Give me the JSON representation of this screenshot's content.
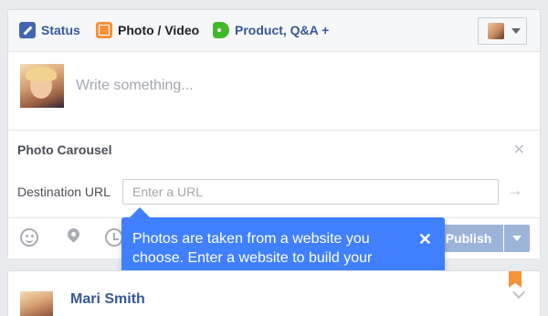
{
  "tabs": [
    {
      "label": "Status",
      "icon": "pencil-icon"
    },
    {
      "label": "Photo / Video",
      "icon": "photo-icon"
    },
    {
      "label": "Product, Q&A +",
      "icon": "tag-icon"
    }
  ],
  "composer": {
    "placeholder": "Write something...",
    "value": ""
  },
  "carousel": {
    "title": "Photo Carousel",
    "close_glyph": "✕",
    "url_label": "Destination URL",
    "url_placeholder": "Enter a URL",
    "url_value": "",
    "submit_glyph": "→"
  },
  "footer": {
    "publish_label": "Publish"
  },
  "tooltip": {
    "text": "Photos are taken from a website you choose. Enter a website to build your photo carousel.",
    "close_glyph": "✕"
  },
  "post": {
    "author": "Mari Smith",
    "meta": "· · ·"
  },
  "colors": {
    "accent_blue": "#4080ff",
    "link_blue": "#365899",
    "publish_disabled": "#9cb4d8",
    "ribbon_orange": "#f7923a"
  }
}
